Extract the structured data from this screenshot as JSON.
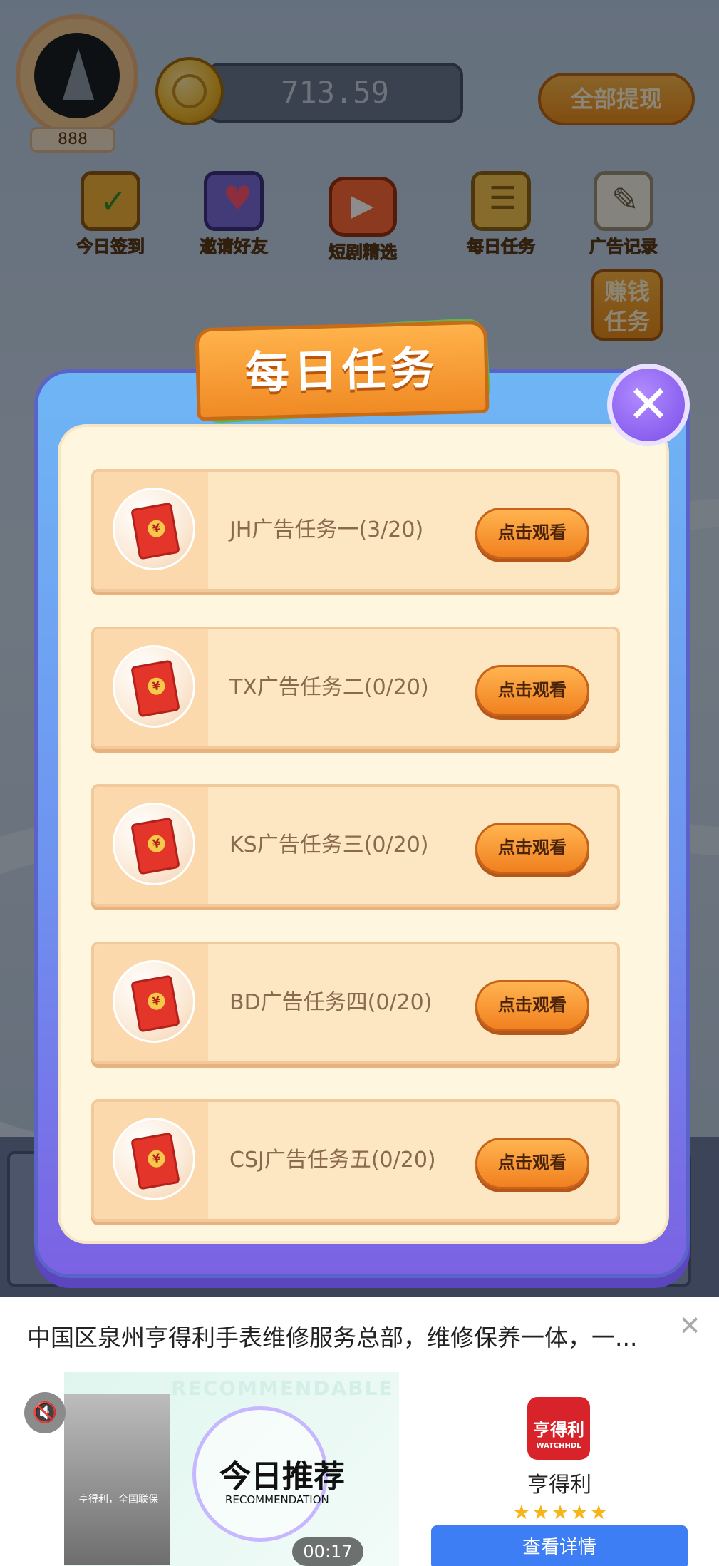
{
  "header": {
    "level": "888",
    "balance": "713.59",
    "withdraw_all": "全部提现"
  },
  "nav": [
    {
      "label": "今日签到",
      "icon": "calendar-check-icon"
    },
    {
      "label": "邀请好友",
      "icon": "invite-envelope-icon"
    },
    {
      "label": "短剧精选",
      "icon": "tv-play-icon"
    },
    {
      "label": "每日任务",
      "icon": "task-list-icon"
    },
    {
      "label": "广告记录",
      "icon": "pencil-note-icon"
    }
  ],
  "earn_task": "赚钱任务",
  "modal": {
    "title": "每日任务",
    "close_icon": "close-icon",
    "tasks": [
      {
        "label": "JH广告任务一(3/20)",
        "button": "点击观看"
      },
      {
        "label": "TX广告任务二(0/20)",
        "button": "点击观看"
      },
      {
        "label": "KS广告任务三(0/20)",
        "button": "点击观看"
      },
      {
        "label": "BD广告任务四(0/20)",
        "button": "点击观看"
      },
      {
        "label": "CSJ广告任务五(0/20)",
        "button": "点击观看"
      }
    ]
  },
  "ad": {
    "title": "中国区泉州亨得利手表维修服务总部，维修保养一体，一...",
    "video_watermark": "RECOMMENDABLE",
    "video_headline": "今日推荐",
    "video_subline": "RECOMMENDATION",
    "video_photo_caption": "亨得利，全国联保",
    "timer": "00:17",
    "brand_logo_text": "亨得利",
    "brand_logo_sub": "WATCHHDL",
    "brand_name": "亨得利",
    "rating_stars": 5,
    "detail_button": "查看详情"
  },
  "colors": {
    "modal_blue": "#6e93f0",
    "title_orange": "#f08a24",
    "button_orange": "#f1801f",
    "detail_blue": "#3d7ef5",
    "close_purple": "#7a4ee8"
  }
}
